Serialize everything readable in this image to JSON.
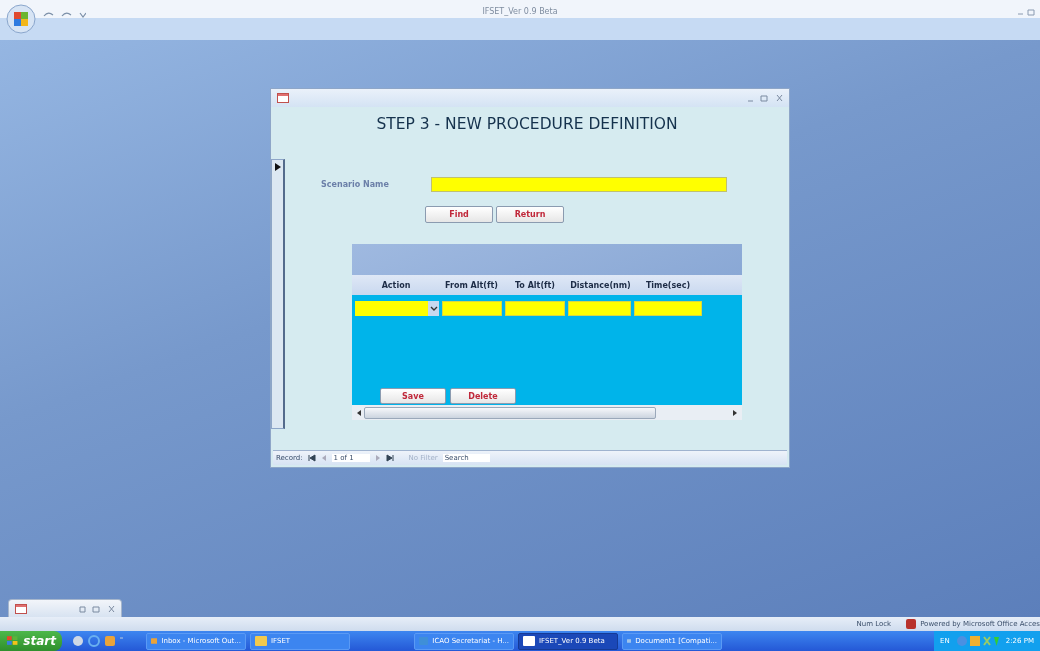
{
  "app": {
    "title": "IFSET_Ver 0.9 Beta"
  },
  "form": {
    "heading": "STEP 3 - NEW PROCEDURE DEFINITION",
    "scenario_label": "Scenario Name",
    "buttons": [
      "Find",
      "Return"
    ],
    "grid": {
      "columns": [
        "Action",
        "From Alt(ft)",
        "To Alt(ft)",
        "Distance(nm)",
        "Time(sec)"
      ],
      "buttons": [
        "Save",
        "Delete"
      ]
    },
    "navigation": {
      "label": "Record:",
      "position": "1 of 1",
      "filter": {
        "label": "No Filter",
        "disabled": true
      },
      "search": "Search"
    }
  },
  "status_bar": {
    "items": [
      "Num Lock",
      "Powered by Microsoft Office Acces"
    ]
  },
  "taskbar": {
    "start": "start",
    "items": [
      {
        "label": "Inbox - Microsoft Out...",
        "kind": "mail",
        "selected": false
      },
      {
        "label": "IFSET",
        "kind": "folder",
        "selected": false
      },
      {
        "label": "ICAO Secretariat - H...",
        "kind": "browser",
        "selected": false
      },
      {
        "label": "IFSET_Ver 0.9 Beta",
        "kind": "access",
        "selected": true
      },
      {
        "label": "Document1 [Compati...",
        "kind": "document",
        "selected": false
      }
    ],
    "tray": {
      "language": "EN",
      "time": "2:26 PM"
    }
  }
}
